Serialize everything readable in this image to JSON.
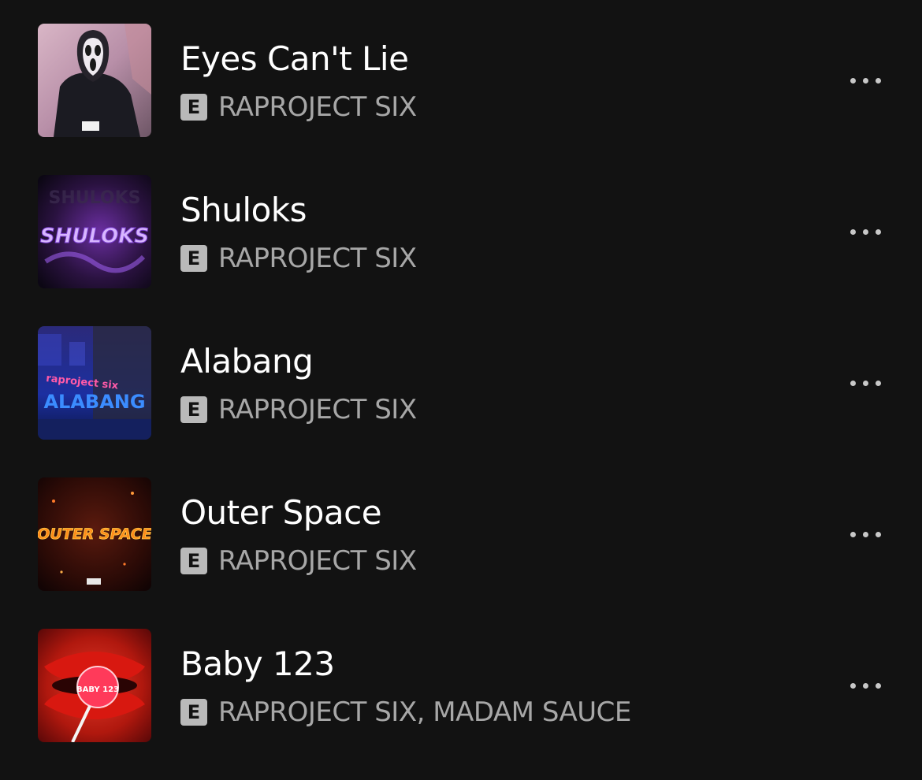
{
  "tracks": [
    {
      "title": "Eyes Can't Lie",
      "explicit_label": "E",
      "artist": "RAPROJECT SIX",
      "cover_text": ""
    },
    {
      "title": "Shuloks",
      "explicit_label": "E",
      "artist": "RAPROJECT SIX",
      "cover_text": "SHULOKS"
    },
    {
      "title": "Alabang",
      "explicit_label": "E",
      "artist": "RAPROJECT SIX",
      "cover_text": "ALABANG"
    },
    {
      "title": "Outer Space",
      "explicit_label": "E",
      "artist": "RAPROJECT SIX",
      "cover_text": "OUTER SPACE"
    },
    {
      "title": "Baby 123",
      "explicit_label": "E",
      "artist": "RAPROJECT SIX, MADAM SAUCE",
      "cover_text": "BABY 123"
    }
  ],
  "colors": {
    "background": "#121212",
    "title": "#ffffff",
    "artist": "#a7a7a7",
    "badge": "#b9b9b9",
    "more_icon": "#c8c8c8"
  },
  "icons": {
    "explicit": "explicit-badge",
    "more": "more-options-icon"
  }
}
